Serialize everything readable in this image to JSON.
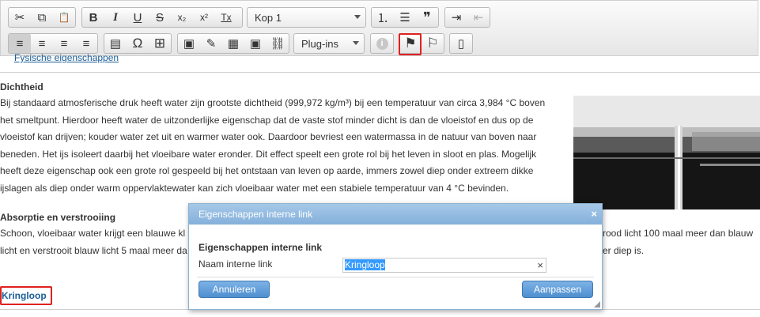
{
  "toolbar": {
    "row1": {
      "cut": "✂",
      "copy": "⧉",
      "paste": "📋",
      "bold": "B",
      "italic": "I",
      "underline": "U",
      "strike": "S",
      "subscript": "x₂",
      "superscript": "x²",
      "remove_format": "Tx",
      "format_value": "Kop 1",
      "numbered_list": "⒈",
      "bullet_list": "☰",
      "blockquote": "❞",
      "indent": "⇥",
      "outdent": "⇤"
    },
    "row2": {
      "align_left": "≡",
      "align_center": "≡",
      "align_right": "≡",
      "justify": "≡",
      "hr": "▤",
      "special_char": "Ω",
      "table": "⊞",
      "image": "▣",
      "tools": "✎",
      "media": "▦",
      "gallery": "▣",
      "link": "⛓",
      "plugins_value": "Plug-ins",
      "info": "i",
      "anchor": "⚑",
      "anchor_remove": "⚐",
      "source": "▯"
    }
  },
  "article": {
    "top_link": "Fysische eigenschappen",
    "heading1": "Dichtheid",
    "paragraph1": [
      "Bij standaard atmosferische druk heeft water zijn grootste dichtheid (999,972 kg/m³) bij een temperatuur van circa 3,984 °C boven",
      "het smeltpunt. Hierdoor heeft water de uitzonderlijke eigenschap dat de vaste stof minder dicht is dan de vloeistof en dus op de",
      "vloeistof kan drijven; kouder water zet uit en warmer water ook. Daardoor bevriest een watermassa in de natuur van boven naar",
      "beneden. Het ijs isoleert daarbij het vloeibare water eronder. Dit effect speelt een grote rol bij het leven in sloot en plas. Mogelijk",
      "heeft deze eigenschap ook een grote rol gespeeld bij het ontstaan van leven op aarde, immers zowel diep onder extreem dikke",
      "ijslagen als diep onder warm oppervlaktewater kan zich vloeibaar water met een stabiele temperatuur van 4 °C bevinden."
    ],
    "heading2": "Absorptie en verstrooiing",
    "paragraph2_line1_left": "Schoon, vloeibaar water krijgt een blauwe kl",
    "paragraph2_line1_right": "rood licht 100 maal meer dan blauw",
    "paragraph2_line2_left": "licht en verstrooit blauw licht 5 maal meer da",
    "paragraph2_line2_right": "er diep is.",
    "anchor_link": "Kringloop"
  },
  "dialog": {
    "title": "Eigenschappen interne link",
    "close": "×",
    "section_title": "Eigenschappen interne link",
    "field_label": "Naam interne link",
    "field_value": "Kringloop",
    "clear": "×",
    "cancel_label": "Annuleren",
    "ok_label": "Aanpassen"
  },
  "colors": {
    "accent": "#4e8fcf",
    "highlight": "#e02020",
    "link": "#1b5e97"
  }
}
